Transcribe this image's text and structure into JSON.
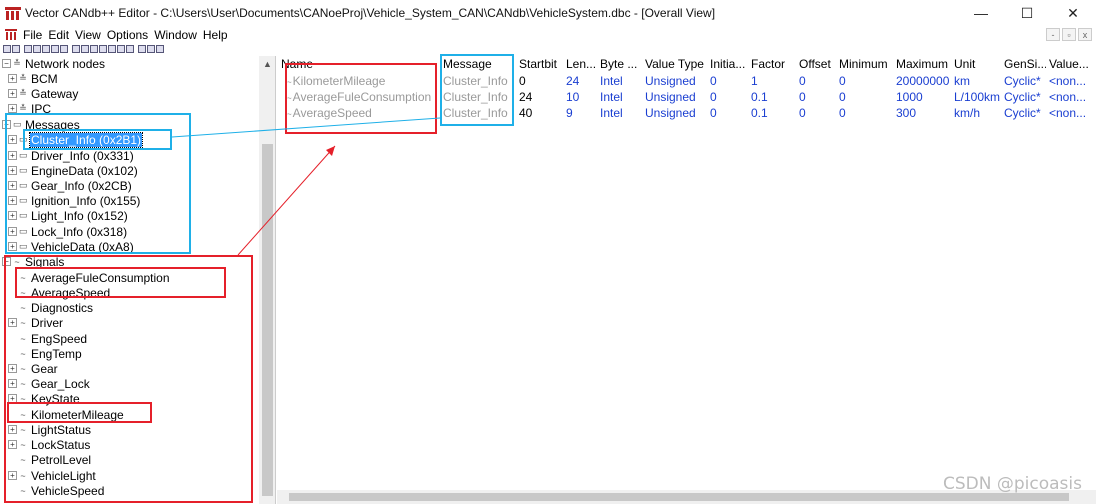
{
  "window": {
    "title": "Vector CANdb++ Editor - C:\\Users\\User\\Documents\\CANoeProj\\Vehicle_System_CAN\\CANdb\\VehicleSystem.dbc - [Overall View]",
    "controls": {
      "minimize": "—",
      "maximize": "☐",
      "close": "✕"
    }
  },
  "menu": {
    "items": [
      "File",
      "Edit",
      "View",
      "Options",
      "Window",
      "Help"
    ],
    "mdi": [
      "-",
      "▫",
      "x"
    ]
  },
  "tree": {
    "network_nodes": {
      "label": "Network nodes",
      "children": [
        "BCM",
        "Gateway",
        "IPC"
      ]
    },
    "messages": {
      "label": "Messages",
      "children": [
        "Cluster_Info (0x2B1)",
        "Driver_Info (0x331)",
        "EngineData (0x102)",
        "Gear_Info (0x2CB)",
        "Ignition_Info (0x155)",
        "Light_Info (0x152)",
        "Lock_Info (0x318)",
        "VehicleData (0xA8)"
      ]
    },
    "signals": {
      "label": "Signals",
      "children": [
        "AverageFuleConsumption",
        "AverageSpeed",
        "Diagnostics",
        "Driver",
        "EngSpeed",
        "EngTemp",
        "Gear",
        "Gear_Lock",
        "KeyState",
        "KilometerMileage",
        "LightStatus",
        "LockStatus",
        "PetrolLevel",
        "VehicleLight",
        "VehicleSpeed"
      ]
    }
  },
  "grid": {
    "columns": [
      "Name",
      "Message",
      "Startbit",
      "Len...",
      "Byte ...",
      "Value Type",
      "Initia...",
      "Factor",
      "Offset",
      "Minimum",
      "Maximum",
      "Unit",
      "GenSi...",
      "Value..."
    ],
    "rows": [
      [
        "KilometerMileage",
        "Cluster_Info",
        "0",
        "24",
        "Intel",
        "Unsigned",
        "0",
        "1",
        "0",
        "0",
        "20000000",
        "km",
        "Cyclic*",
        "<non..."
      ],
      [
        "AverageFuleConsumption",
        "Cluster_Info",
        "24",
        "10",
        "Intel",
        "Unsigned",
        "0",
        "0.1",
        "0",
        "0",
        "1000",
        "L/100km",
        "Cyclic*",
        "<non..."
      ],
      [
        "AverageSpeed",
        "Cluster_Info",
        "40",
        "9",
        "Intel",
        "Unsigned",
        "0",
        "0.1",
        "0",
        "0",
        "300",
        "km/h",
        "Cyclic*",
        "<non..."
      ]
    ]
  },
  "watermark": "CSDN @picoasis",
  "colors": {
    "selection": "#3399ff",
    "annotation_red": "#e5202a",
    "annotation_blue": "#1fb0e8",
    "value_blue": "#1a3ed1"
  }
}
